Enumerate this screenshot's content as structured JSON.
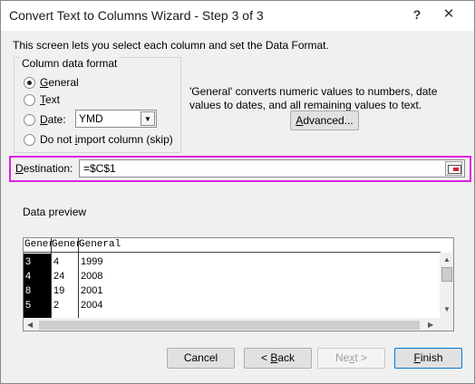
{
  "window": {
    "title": "Convert Text to Columns Wizard - Step 3 of 3",
    "help_glyph": "?",
    "close_glyph": "✕"
  },
  "intro": "This screen lets you select each column and set the Data Format.",
  "column_format": {
    "legend": "Column data format",
    "options": [
      {
        "pre": "",
        "mn": "G",
        "post": "eneral",
        "checked": true
      },
      {
        "pre": "",
        "mn": "T",
        "post": "ext",
        "checked": false
      },
      {
        "pre": "",
        "mn": "D",
        "post": "ate:",
        "checked": false
      },
      {
        "pre": "Do not ",
        "mn": "i",
        "post": "mport column (skip)",
        "checked": false
      }
    ],
    "date_format": "YMD",
    "date_dropdown_glyph": "▼"
  },
  "explanation": "'General' converts numeric values to numbers, date values to dates, and all remaining values to text.",
  "advanced": {
    "pre": "",
    "mn": "A",
    "post": "dvanced..."
  },
  "destination": {
    "label_pre": "",
    "label_mn": "D",
    "label_post": "estination:",
    "value": "=$C$1"
  },
  "preview": {
    "label": "Data preview",
    "headers": [
      "Gener",
      "Gener",
      "General"
    ],
    "rows": [
      [
        "3",
        "4",
        "1999"
      ],
      [
        "4",
        "24",
        "2008"
      ],
      [
        "8",
        "19",
        "2001"
      ],
      [
        "5",
        "2",
        "2004"
      ]
    ],
    "scroll_up": "▲",
    "scroll_down": "▼",
    "scroll_left": "◀",
    "scroll_right": "▶"
  },
  "buttons": {
    "cancel": "Cancel",
    "back": {
      "pre": "< ",
      "mn": "B",
      "post": "ack"
    },
    "next": {
      "pre": "Ne",
      "mn": "x",
      "post": "t >"
    },
    "finish": {
      "pre": "",
      "mn": "F",
      "post": "inish"
    }
  }
}
